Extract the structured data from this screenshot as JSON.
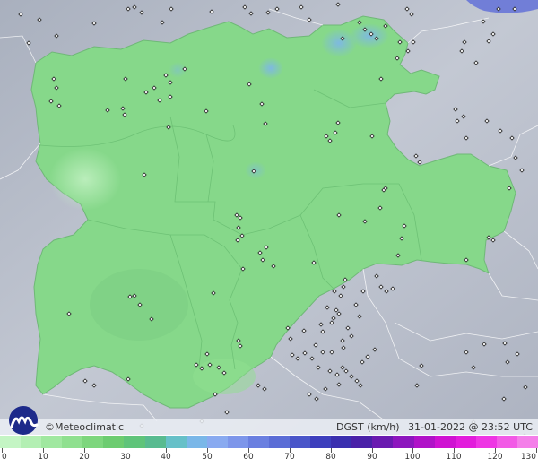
{
  "brand": {
    "logo_icon": "meteoclimatic-logo-icon",
    "copyright": "©",
    "name": "Meteoclimatic"
  },
  "status": {
    "variable": "DGST (km/h)",
    "datetime": "31-01-2022 @ 23:52 UTC"
  },
  "legend": {
    "labels": [
      "0",
      "10",
      "20",
      "30",
      "40",
      "50",
      "60",
      "70",
      "80",
      "90",
      "100",
      "110",
      "120",
      "130"
    ],
    "colors": [
      "#c4f5c4",
      "#b3efb3",
      "#a0e8a0",
      "#8fe08f",
      "#7dd67d",
      "#6ccc70",
      "#5fc47a",
      "#58bb90",
      "#66c0c8",
      "#7ab7e8",
      "#89aaf0",
      "#7d96ea",
      "#6a7fe0",
      "#5b6dd6",
      "#4a56c9",
      "#3d3fbd",
      "#3a2faf",
      "#4a21a8",
      "#6a1ab0",
      "#8d16be",
      "#b012c8",
      "#cf12d2",
      "#e21cdc",
      "#ee35e4",
      "#f25ae6",
      "#f47fe9"
    ],
    "max": 130
  },
  "map": {
    "region_fill": "#86d88a",
    "background": "#b9bfcc",
    "station_count_hint": "weather stations",
    "stations": [
      [
        60,
        88
      ],
      [
        63,
        98
      ],
      [
        57,
        113
      ],
      [
        66,
        118
      ],
      [
        140,
        88
      ],
      [
        185,
        84
      ],
      [
        190,
        92
      ],
      [
        172,
        98
      ],
      [
        178,
        112
      ],
      [
        190,
        108
      ],
      [
        163,
        103
      ],
      [
        137,
        121
      ],
      [
        120,
        123
      ],
      [
        139,
        128
      ],
      [
        206,
        77
      ],
      [
        230,
        124
      ],
      [
        292,
        116
      ],
      [
        296,
        138
      ],
      [
        188,
        142
      ],
      [
        278,
        94
      ],
      [
        283,
        191
      ],
      [
        161,
        195
      ],
      [
        264,
        240
      ],
      [
        268,
        243
      ],
      [
        266,
        254
      ],
      [
        270,
        263
      ],
      [
        265,
        268
      ],
      [
        290,
        282
      ],
      [
        293,
        290
      ],
      [
        297,
        276
      ],
      [
        271,
        300
      ],
      [
        305,
        297
      ],
      [
        350,
        293
      ],
      [
        378,
        240
      ],
      [
        407,
        247
      ],
      [
        428,
        212
      ],
      [
        368,
        157
      ],
      [
        374,
        148
      ],
      [
        377,
        137
      ],
      [
        364,
        152
      ],
      [
        415,
        152
      ],
      [
        464,
        174
      ],
      [
        468,
        181
      ],
      [
        508,
        122
      ],
      [
        517,
        130
      ],
      [
        510,
        135
      ],
      [
        425,
        88
      ],
      [
        382,
        43
      ],
      [
        414,
        38
      ],
      [
        420,
        43
      ],
      [
        430,
        29
      ],
      [
        407,
        33
      ],
      [
        446,
        47
      ],
      [
        401,
        25
      ],
      [
        443,
        65
      ],
      [
        455,
        57
      ],
      [
        461,
        47
      ],
      [
        520,
        290
      ],
      [
        545,
        265
      ],
      [
        550,
        268
      ],
      [
        150,
        330
      ],
      [
        145,
        331
      ],
      [
        156,
        340
      ],
      [
        77,
        350
      ],
      [
        238,
        327
      ],
      [
        169,
        356
      ],
      [
        266,
        380
      ],
      [
        268,
        386
      ],
      [
        234,
        407
      ],
      [
        244,
        410
      ],
      [
        250,
        416
      ],
      [
        231,
        395
      ],
      [
        240,
        440
      ],
      [
        219,
        407
      ],
      [
        225,
        411
      ],
      [
        143,
        423
      ],
      [
        95,
        425
      ],
      [
        105,
        430
      ],
      [
        158,
        475
      ],
      [
        225,
        470
      ],
      [
        253,
        460
      ],
      [
        288,
        430
      ],
      [
        295,
        434
      ],
      [
        321,
        366
      ],
      [
        324,
        378
      ],
      [
        339,
        369
      ],
      [
        358,
        362
      ],
      [
        360,
        370
      ],
      [
        365,
        343
      ],
      [
        372,
        355
      ],
      [
        375,
        346
      ],
      [
        378,
        350
      ],
      [
        370,
        360
      ],
      [
        382,
        380
      ],
      [
        383,
        388
      ],
      [
        370,
        393
      ],
      [
        352,
        385
      ],
      [
        360,
        393
      ],
      [
        348,
        400
      ],
      [
        340,
        394
      ],
      [
        332,
        400
      ],
      [
        326,
        396
      ],
      [
        355,
        410
      ],
      [
        368,
        414
      ],
      [
        376,
        418
      ],
      [
        382,
        410
      ],
      [
        386,
        414
      ],
      [
        392,
        420
      ],
      [
        398,
        425
      ],
      [
        402,
        430
      ],
      [
        378,
        429
      ],
      [
        363,
        434
      ],
      [
        345,
        440
      ],
      [
        353,
        445
      ],
      [
        404,
        404
      ],
      [
        410,
        398
      ],
      [
        418,
        390
      ],
      [
        388,
        366
      ],
      [
        392,
        375
      ],
      [
        397,
        340
      ],
      [
        401,
        353
      ],
      [
        420,
        308
      ],
      [
        425,
        320
      ],
      [
        431,
        325
      ],
      [
        438,
        322
      ],
      [
        385,
        312
      ],
      [
        380,
        330
      ],
      [
        373,
        325
      ],
      [
        383,
        320
      ],
      [
        405,
        325
      ],
      [
        470,
        408
      ],
      [
        520,
        393
      ],
      [
        540,
        384
      ],
      [
        528,
        410
      ],
      [
        563,
        383
      ],
      [
        577,
        395
      ],
      [
        566,
        404
      ],
      [
        586,
        432
      ],
      [
        562,
        445
      ],
      [
        465,
        430
      ],
      [
        440,
        476
      ],
      [
        515,
        504
      ],
      [
        528,
        471
      ],
      [
        585,
        486
      ],
      [
        556,
        10
      ],
      [
        574,
        10
      ],
      [
        539,
        24
      ],
      [
        550,
        38
      ],
      [
        545,
        46
      ],
      [
        454,
        10
      ],
      [
        459,
        16
      ],
      [
        518,
        47
      ],
      [
        531,
        70
      ],
      [
        515,
        57
      ],
      [
        143,
        10
      ],
      [
        150,
        8
      ],
      [
        158,
        14
      ],
      [
        181,
        25
      ],
      [
        191,
        10
      ],
      [
        236,
        13
      ],
      [
        273,
        8
      ],
      [
        280,
        15
      ],
      [
        309,
        10
      ],
      [
        336,
        8
      ],
      [
        377,
        5
      ],
      [
        345,
        22
      ],
      [
        299,
        14
      ],
      [
        23,
        16
      ],
      [
        44,
        22
      ],
      [
        105,
        26
      ],
      [
        63,
        40
      ],
      [
        32,
        48
      ],
      [
        520,
        154
      ],
      [
        543,
        135
      ],
      [
        558,
        146
      ],
      [
        571,
        154
      ],
      [
        575,
        176
      ],
      [
        582,
        190
      ],
      [
        568,
        210
      ],
      [
        444,
        285
      ],
      [
        448,
        266
      ],
      [
        451,
        252
      ],
      [
        424,
        232
      ],
      [
        430,
        210
      ]
    ]
  }
}
